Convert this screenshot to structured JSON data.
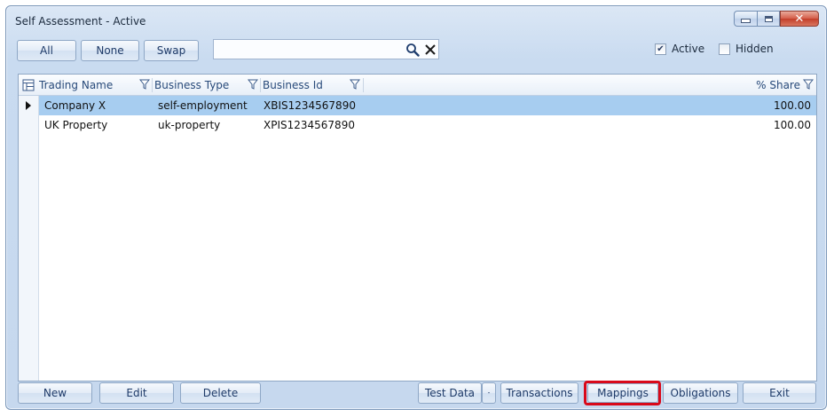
{
  "window": {
    "title": "Self Assessment - Active"
  },
  "toolbar": {
    "all_label": "All",
    "none_label": "None",
    "swap_label": "Swap",
    "search_value": "",
    "search_placeholder": "",
    "active_label": "Active",
    "active_checked": true,
    "hidden_label": "Hidden",
    "hidden_checked": false
  },
  "grid": {
    "columns": [
      "Trading Name",
      "Business Type",
      "Business Id",
      "% Share"
    ],
    "rows": [
      {
        "trading_name": "Company X",
        "business_type": "self-employment",
        "business_id": "XBIS1234567890",
        "share": "100.00",
        "selected": true
      },
      {
        "trading_name": "UK Property",
        "business_type": "uk-property",
        "business_id": "XPIS1234567890",
        "share": "100.00",
        "selected": false
      }
    ]
  },
  "actions": {
    "new_label": "New",
    "edit_label": "Edit",
    "delete_label": "Delete",
    "test_data_label": "Test Data",
    "transactions_label": "Transactions",
    "mappings_label": "Mappings",
    "obligations_label": "Obligations",
    "exit_label": "Exit"
  },
  "colors": {
    "selected_row": "#a7cdf0",
    "highlight": "#d9091a",
    "header_text": "#284a7a"
  },
  "icons": {
    "search": "search-icon",
    "clear": "clear-icon",
    "filter": "filter-icon",
    "column_chooser": "column-chooser-icon",
    "current_row": "current-row-arrow-icon"
  }
}
